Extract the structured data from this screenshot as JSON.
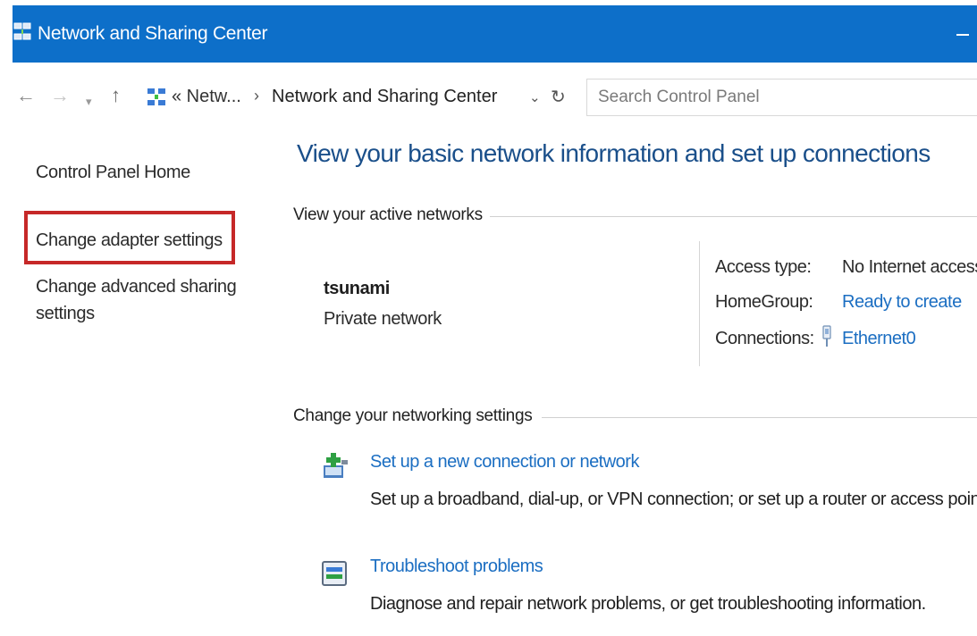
{
  "window": {
    "title": "Network and Sharing Center"
  },
  "nav": {
    "back_icon": "arrow-left-icon",
    "forward_icon": "arrow-right-icon",
    "recent_icon": "chevron-down-icon",
    "up_icon": "arrow-up-icon",
    "back_glyph": "←",
    "forward_glyph": "→",
    "recent_glyph": "▾",
    "up_glyph": "↑"
  },
  "address": {
    "crumb1": "« Netw...",
    "separator": "›",
    "crumb2": "Network and Sharing Center",
    "dropdown_glyph": "⌄",
    "refresh_glyph": "↻"
  },
  "search": {
    "placeholder": "Search Control Panel"
  },
  "sidebar": {
    "home": "Control Panel Home",
    "adapter": "Change adapter settings",
    "sharing_line1": "Change advanced sharing",
    "sharing_line2": "settings"
  },
  "main": {
    "heading": "View your basic network information and set up connections",
    "active_networks_label": "View your active networks",
    "network": {
      "name": "tsunami",
      "type": "Private network",
      "access_type_label": "Access type:",
      "access_type_value": "No Internet access",
      "homegroup_label": "HomeGroup:",
      "homegroup_value": "Ready to create",
      "connections_label": "Connections:",
      "connections_value": "Ethernet0"
    },
    "change_settings_label": "Change your networking settings",
    "tasks": [
      {
        "link": "Set up a new connection or network",
        "description": "Set up a broadband, dial-up, or VPN connection; or set up a router or access point."
      },
      {
        "link": "Troubleshoot problems",
        "description": "Diagnose and repair network problems, or get troubleshooting information."
      }
    ]
  },
  "colors": {
    "titlebar": "#0d6fc9",
    "link": "#1b6ec2",
    "heading": "#1a4f8a",
    "highlight": "#c62828"
  }
}
